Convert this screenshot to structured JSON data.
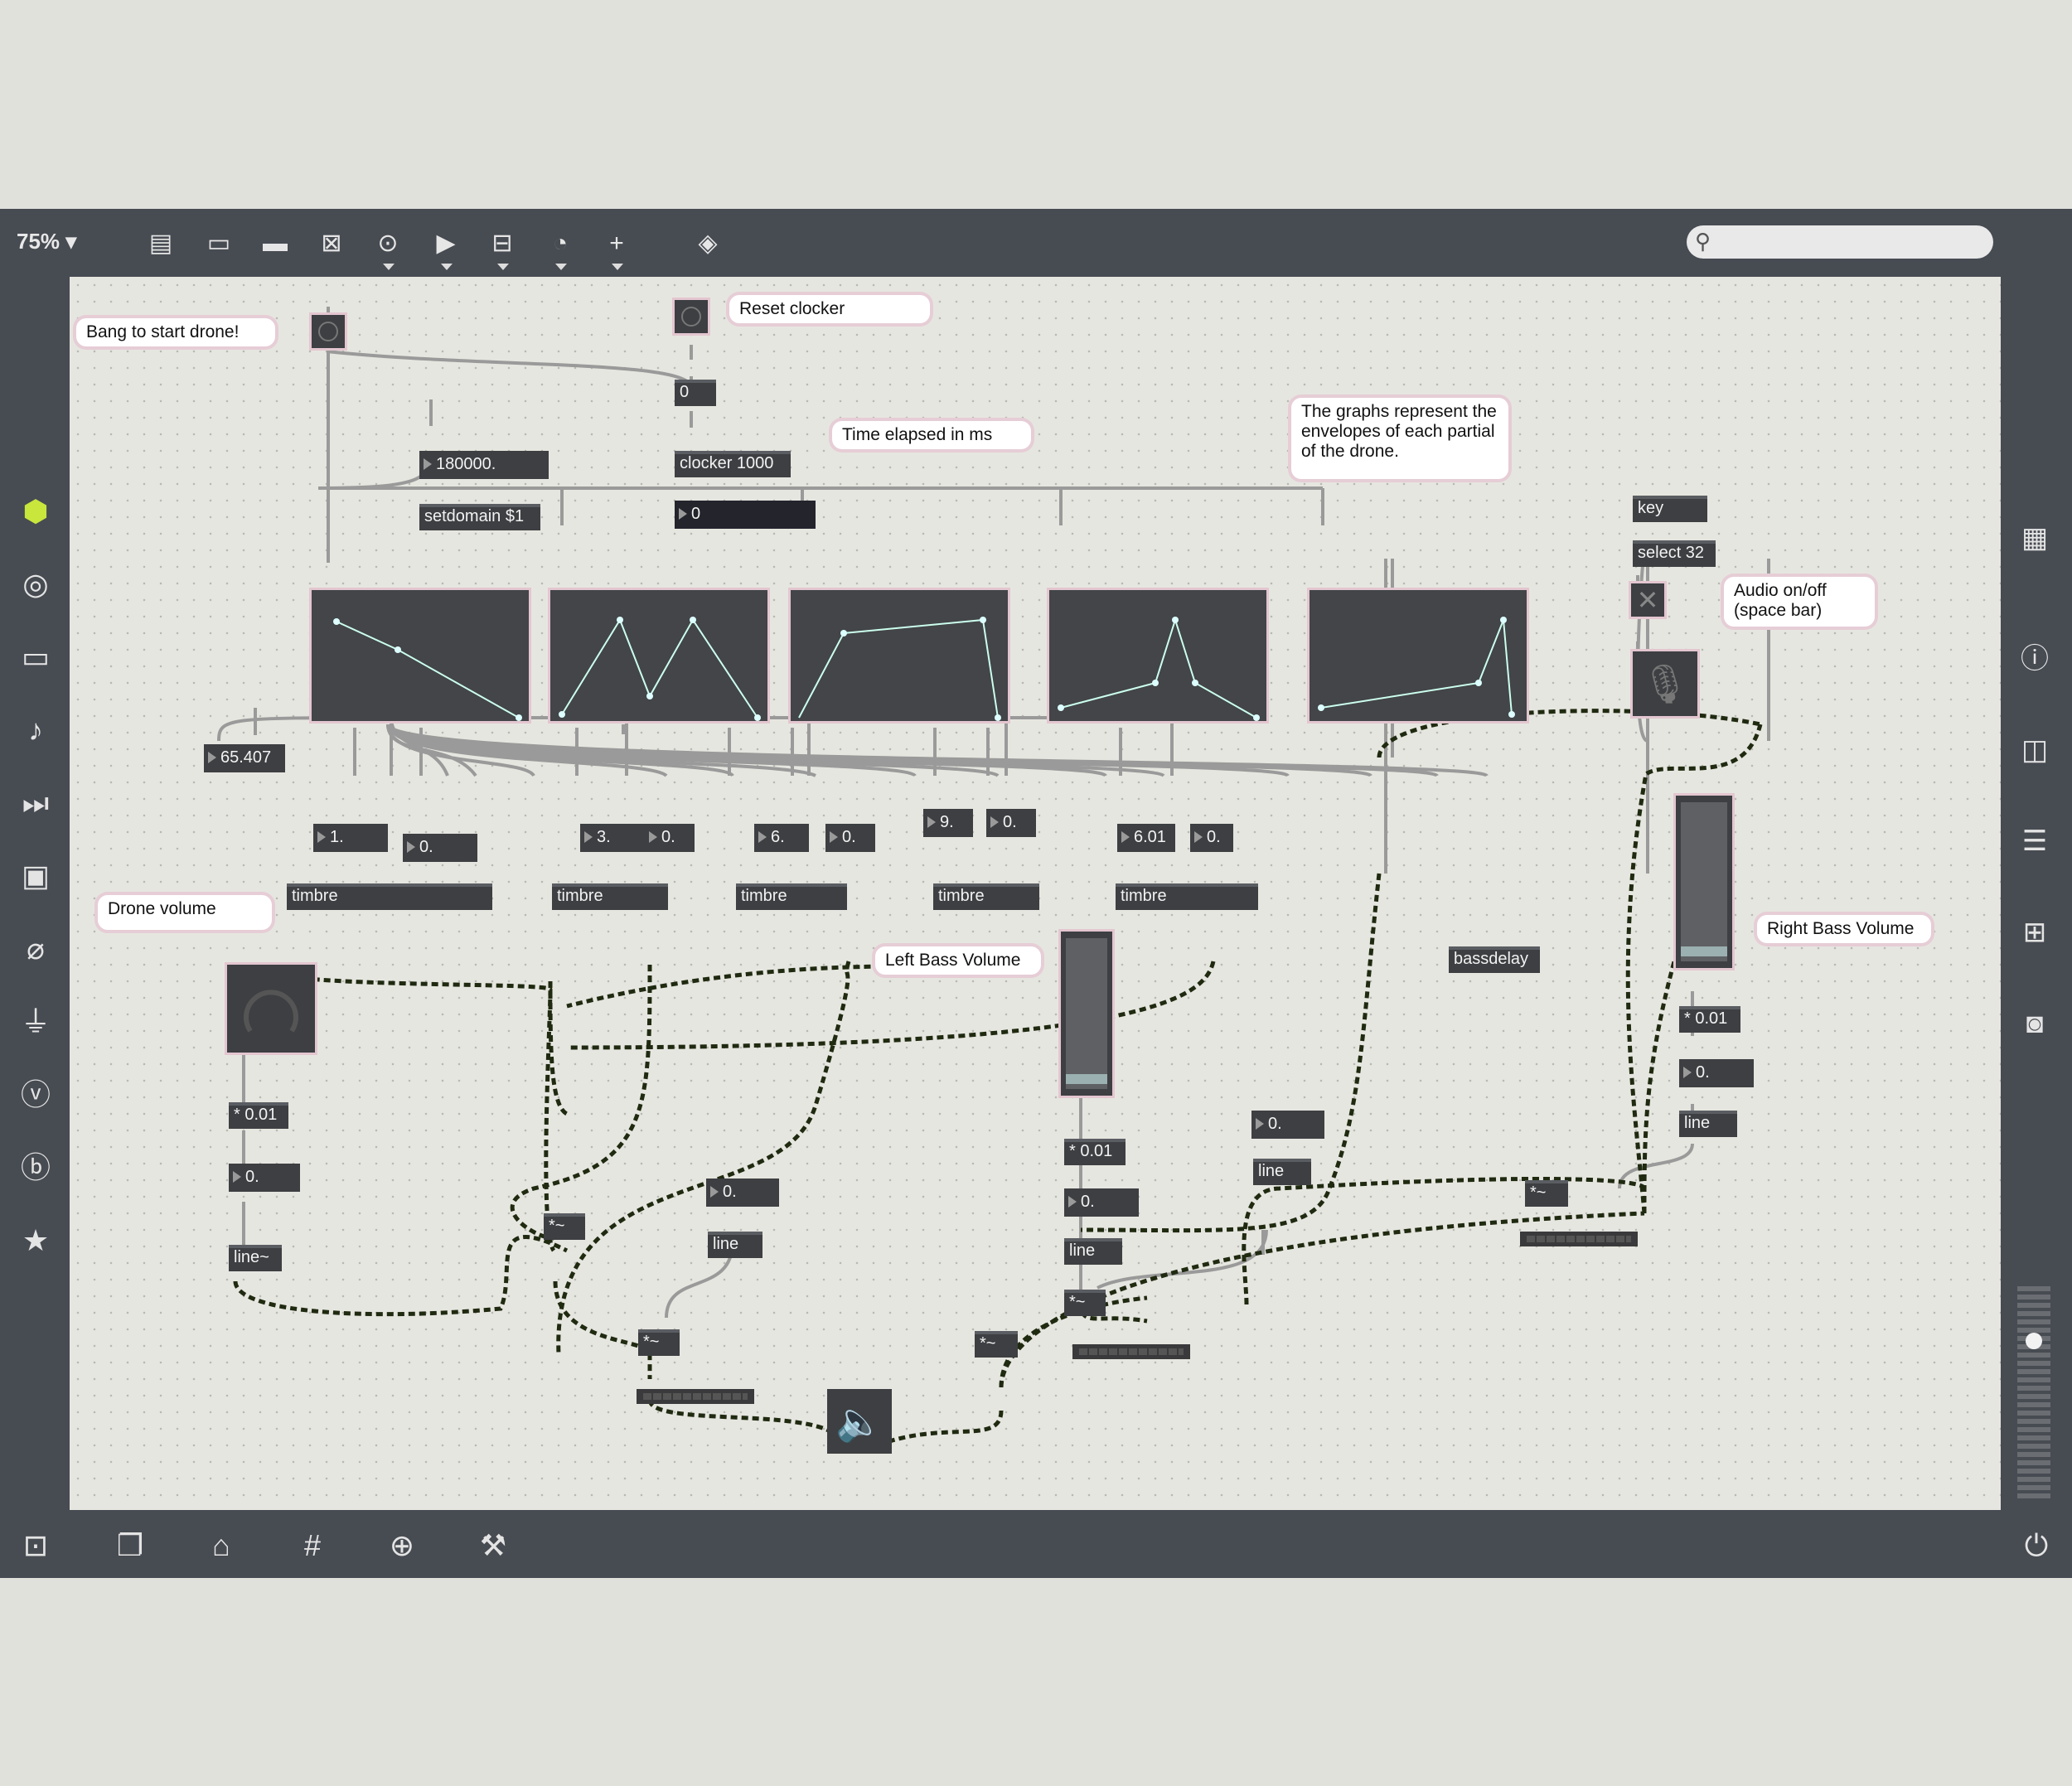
{
  "toolbar": {
    "zoom": "75%",
    "icons": [
      "presentation-icon",
      "message-icon",
      "comment-icon",
      "toggle-icon",
      "button-icon",
      "play-icon",
      "slider-icon",
      "dial-icon",
      "plus-icon",
      "paint-bucket-icon"
    ]
  },
  "left_sidebar": [
    "cube-icon",
    "circle-icon",
    "film-icon",
    "note-icon",
    "media-icon",
    "image-icon",
    "paperclip-icon",
    "plug-icon",
    "vimeo-icon",
    "b-icon",
    "star-icon"
  ],
  "right_sidebar": [
    "grid-icon",
    "info-icon",
    "columns-icon",
    "list-icon",
    "book-icon",
    "camera-icon"
  ],
  "bottom_bar": [
    "lock-icon",
    "windows-icon",
    "presentation-icon",
    "grid-icon",
    "paperclip-add-icon",
    "wrench-icon",
    "power-icon"
  ],
  "patch": {
    "comments": {
      "bang_start": "Bang to start drone!",
      "reset_clocker": "Reset clocker",
      "time_elapsed": "Time elapsed in ms",
      "graphs_info": "The graphs represent the envelopes of each partial of the drone.",
      "audio_onoff": "Audio on/off (space bar)",
      "drone_volume": "Drone volume",
      "left_bass": "Left Bass Volume",
      "right_bass": "Right Bass Volume"
    },
    "objects": {
      "msg_zero": "0",
      "clocker": "clocker 1000",
      "num_domain": "180000.",
      "setdomain": "setdomain $1",
      "clock_out": "0",
      "key": "key",
      "select": "select 32",
      "freq": "65.407",
      "n1": "1.",
      "n1b": "0.",
      "n3": "3.",
      "n3b": "0.",
      "n6": "6.",
      "n6b": "0.",
      "n9": "9.",
      "n9b": "0.",
      "n601": "6.01",
      "n601b": "0.",
      "timbre": "timbre",
      "bassdelay": "bassdelay",
      "mul001": "* 0.01",
      "zero": "0.",
      "line_sig": "line~",
      "line": "line",
      "multsig": "*~"
    }
  }
}
